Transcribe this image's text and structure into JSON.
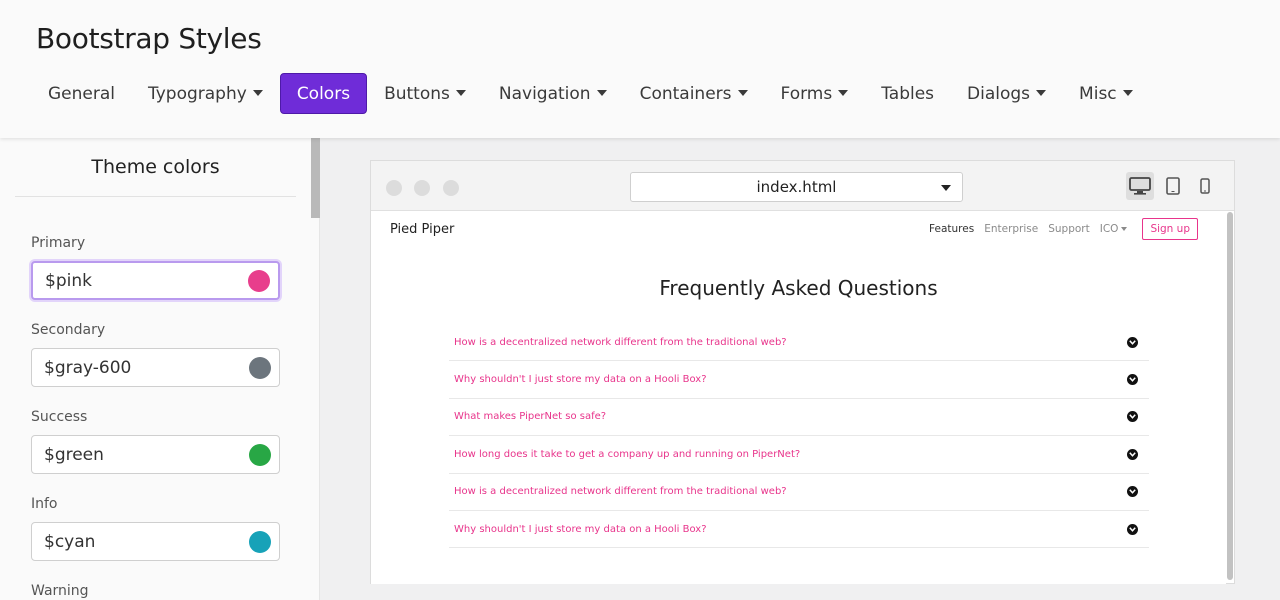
{
  "app": {
    "title": "Bootstrap Styles"
  },
  "nav": [
    {
      "label": "General",
      "dropdown": false,
      "active": false
    },
    {
      "label": "Typography",
      "dropdown": true,
      "active": false
    },
    {
      "label": "Colors",
      "dropdown": false,
      "active": true
    },
    {
      "label": "Buttons",
      "dropdown": true,
      "active": false
    },
    {
      "label": "Navigation",
      "dropdown": true,
      "active": false
    },
    {
      "label": "Containers",
      "dropdown": true,
      "active": false
    },
    {
      "label": "Forms",
      "dropdown": true,
      "active": false
    },
    {
      "label": "Tables",
      "dropdown": false,
      "active": false
    },
    {
      "label": "Dialogs",
      "dropdown": true,
      "active": false
    },
    {
      "label": "Misc",
      "dropdown": true,
      "active": false
    }
  ],
  "sidebar": {
    "title": "Theme colors",
    "colors": [
      {
        "label": "Primary",
        "value": "$pink",
        "swatch": "#e83e8c",
        "focused": true
      },
      {
        "label": "Secondary",
        "value": "$gray-600",
        "swatch": "#6c757d",
        "focused": false
      },
      {
        "label": "Success",
        "value": "$green",
        "swatch": "#28a745",
        "focused": false
      },
      {
        "label": "Info",
        "value": "$cyan",
        "swatch": "#17a2b8",
        "focused": false
      },
      {
        "label": "Warning",
        "value": "",
        "swatch": "",
        "focused": false
      }
    ]
  },
  "preview": {
    "url": "index.html",
    "devices": [
      "desktop-icon",
      "tablet-icon",
      "mobile-icon"
    ],
    "site": {
      "brand": "Pied Piper",
      "links": [
        {
          "label": "Features",
          "active": true,
          "dropdown": false
        },
        {
          "label": "Enterprise",
          "active": false,
          "dropdown": false
        },
        {
          "label": "Support",
          "active": false,
          "dropdown": false
        },
        {
          "label": "ICO",
          "active": false,
          "dropdown": true
        }
      ],
      "signup": "Sign up",
      "faq_title": "Frequently Asked Questions",
      "faq": [
        "How is a decentralized network different from the traditional web?",
        "Why shouldn't I just store my data on a Hooli Box?",
        "What makes PiperNet so safe?",
        "How long does it take to get a company up and running on PiperNet?",
        "How is a decentralized network different from the traditional web?",
        "Why shouldn't I just store my data on a Hooli Box?"
      ]
    }
  },
  "colors": {
    "accent": "#6f2cd8",
    "link_pink": "#e8348b"
  }
}
